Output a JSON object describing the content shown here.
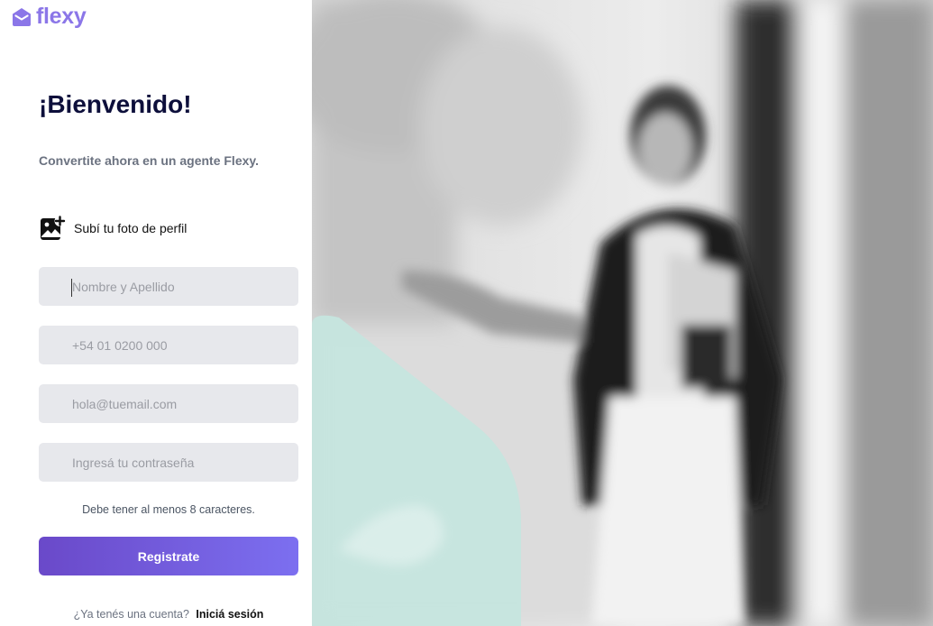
{
  "brand": {
    "name": "flexy",
    "color": "#8b76e8",
    "icon": "house-envelope-icon"
  },
  "header": {
    "title": "¡Bienvenido!",
    "subtitle": "Convertite ahora en un agente Flexy."
  },
  "upload": {
    "label": "Subí tu foto de perfil",
    "icon": "image-add-icon"
  },
  "form": {
    "name_placeholder": "Nombre y Apellido",
    "phone_placeholder": "+54 01 0200 000",
    "email_placeholder": "hola@tuemail.com",
    "password_placeholder": "Ingresá tu contraseña",
    "password_hint": "Debe tener al menos 8 caracteres.",
    "submit_label": "Registrate"
  },
  "footer": {
    "question": "¿Ya tenés una cuenta?",
    "login_link": "Iniciá sesión"
  },
  "colors": {
    "accent": "#7c6ff0",
    "title": "#0d0f3b",
    "input_bg": "#e7e8ec",
    "mint_shape": "#c5e5de"
  }
}
